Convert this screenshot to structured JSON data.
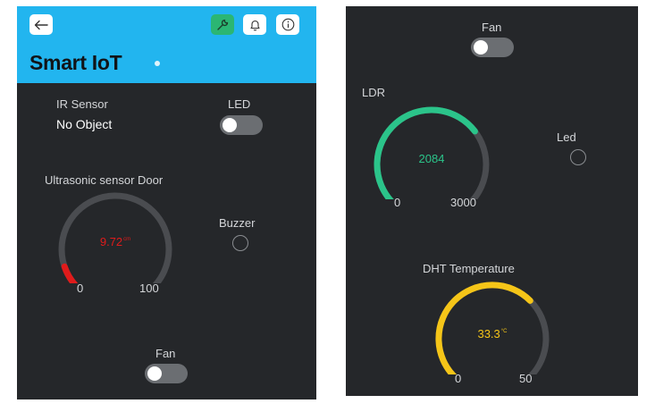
{
  "colors": {
    "header": "#22b5ef",
    "panel": "#25272a",
    "track": "#4a4c50",
    "ultrasonic": "#e01b1b",
    "ldr": "#2bc48a",
    "temperature": "#f5c518"
  },
  "left": {
    "header": {
      "back_icon": "arrow-left-icon",
      "wrench_icon": "wrench-icon",
      "bell_icon": "bell-icon",
      "info_icon": "info-icon",
      "title": "Smart IoT"
    },
    "ir_sensor": {
      "label": "IR Sensor",
      "value": "No Object"
    },
    "led": {
      "label": "LED",
      "on": false
    },
    "ultrasonic": {
      "label": "Ultrasonic sensor Door",
      "value": "9.72",
      "unit": "cm",
      "min": "0",
      "max": "100",
      "fraction": 0.0972
    },
    "buzzer": {
      "label": "Buzzer",
      "on": false
    },
    "fan": {
      "label": "Fan",
      "on": false
    }
  },
  "right": {
    "fan": {
      "label": "Fan",
      "on": false
    },
    "ldr": {
      "label": "LDR",
      "value": "2084",
      "min": "0",
      "max": "3000",
      "fraction": 0.6947
    },
    "led": {
      "label": "Led",
      "on": false
    },
    "dht": {
      "label": "DHT Temperature",
      "value": "33.3",
      "unit": "°C",
      "min": "0",
      "max": "50",
      "fraction": 0.666
    }
  }
}
